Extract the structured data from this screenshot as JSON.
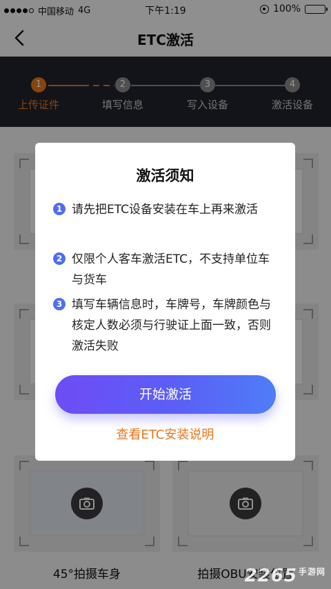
{
  "status_bar": {
    "carrier": "中国移动",
    "network": "4G",
    "time": "下午1:19",
    "battery": "100%",
    "battery_level": 1.0
  },
  "nav": {
    "title": "ETC激活",
    "back_icon": "chevron-left-icon"
  },
  "stepper": {
    "steps": [
      {
        "number": "1",
        "label": "上传证件",
        "active": true
      },
      {
        "number": "2",
        "label": "填写信息",
        "active": false
      },
      {
        "number": "3",
        "label": "写入设备",
        "active": false
      },
      {
        "number": "4",
        "label": "激活设备",
        "active": false
      }
    ],
    "active_color": "#e8761b"
  },
  "background": {
    "photo_labels": [
      "45°拍摄车身",
      "拍摄OBU安装位置"
    ],
    "camera_icon": "camera-icon"
  },
  "modal": {
    "title": "激活须知",
    "notes": [
      {
        "number": "1",
        "text": "请先把ETC设备安装在车上再来激活"
      },
      {
        "number": "2",
        "text": "仅限个人客车激活ETC，不支持单位车与货车"
      },
      {
        "number": "3",
        "text": "填写车辆信息时，车牌号，车牌颜色与核定人数必须与行驶证上面一致，否则激活失败"
      }
    ],
    "start_button": "开始激活",
    "guide_link": "查看ETC安装说明",
    "accent_color": "#4f6df0"
  },
  "watermark": {
    "text": "2265",
    "subtext": "手游网"
  }
}
